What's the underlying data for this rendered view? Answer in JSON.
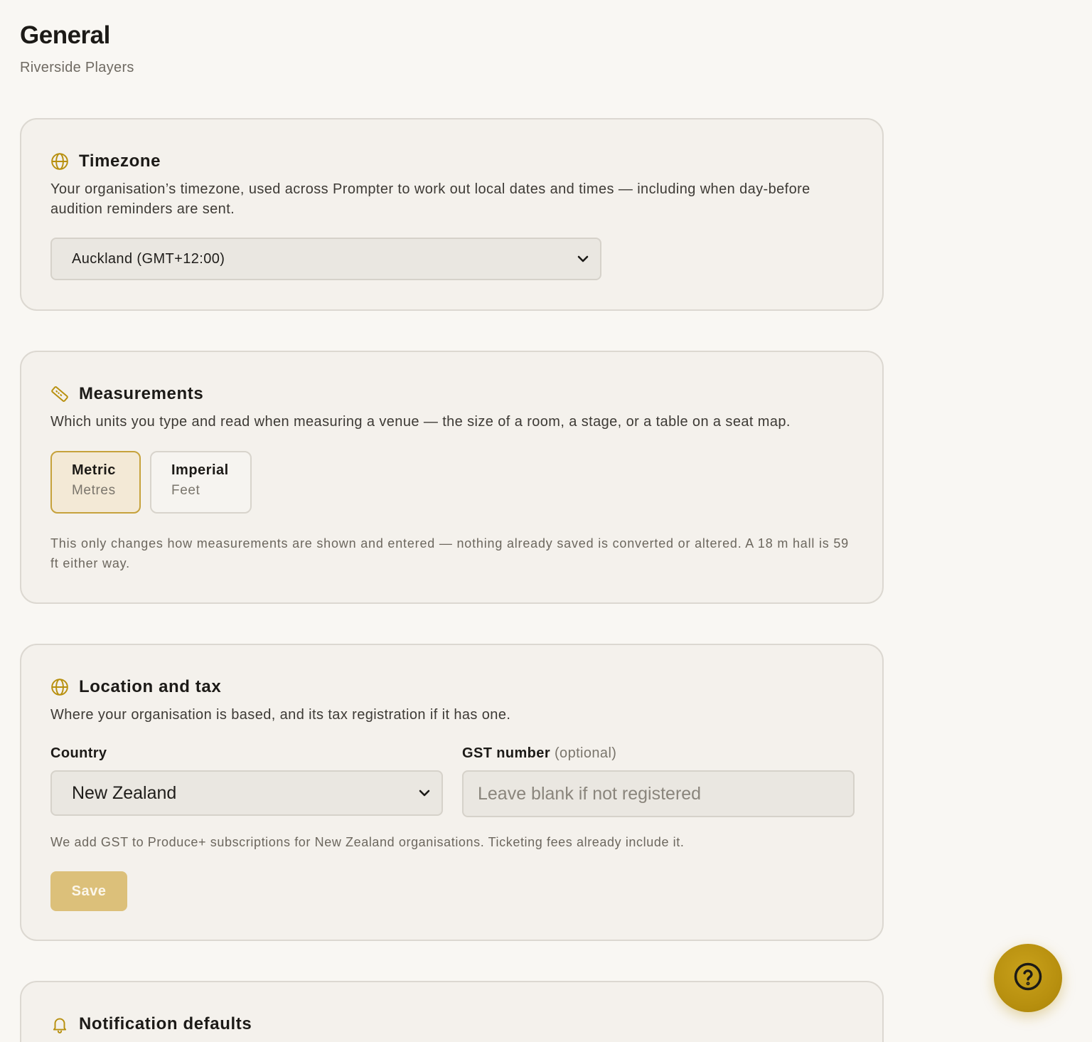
{
  "page": {
    "title": "General",
    "subtitle": "Riverside Players"
  },
  "timezone": {
    "icon": "globe-icon",
    "title": "Timezone",
    "description": "Your organisation’s timezone, used across Prompter to work out local dates and times — including when day-before audition reminders are sent.",
    "selected": "Auckland (GMT+12:00)"
  },
  "measurements": {
    "icon": "ruler-icon",
    "title": "Measurements",
    "description": "Which units you type and read when measuring a venue — the size of a room, a stage, or a table on a seat map.",
    "options": [
      {
        "label": "Metric",
        "sub": "Metres",
        "selected": true
      },
      {
        "label": "Imperial",
        "sub": "Feet",
        "selected": false
      }
    ],
    "note": "This only changes how measurements are shown and entered — nothing already saved is converted or altered. A 18 m hall is 59 ft either way."
  },
  "location": {
    "icon": "globe-icon",
    "title": "Location and tax",
    "description": "Where your organisation is based, and its tax registration if it has one.",
    "country_label": "Country",
    "country_value": "New Zealand",
    "gst_label": "GST number",
    "gst_optional": "(optional)",
    "gst_placeholder": "Leave blank if not registered",
    "note": "We add GST to Produce+ subscriptions for New Zealand organisations. Ticketing fees already include it.",
    "save_label": "Save"
  },
  "notifications": {
    "icon": "bell-icon",
    "title": "Notification defaults"
  },
  "help": {
    "icon": "question-circle-icon"
  },
  "colors": {
    "accent": "#b8900f",
    "accent_light": "#dcc07a",
    "background": "#f9f7f3",
    "card": "#f4f1ec"
  }
}
